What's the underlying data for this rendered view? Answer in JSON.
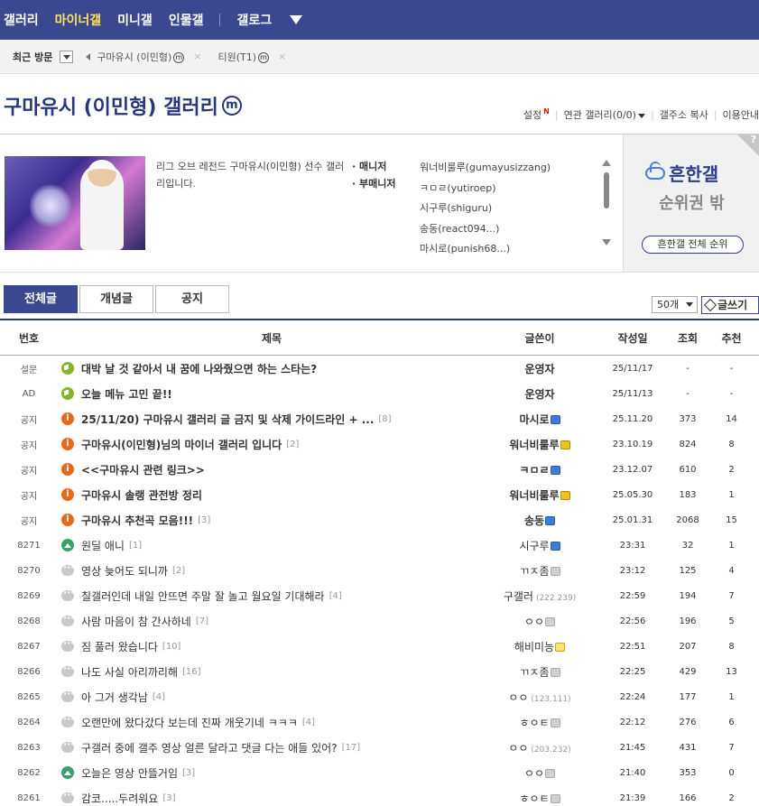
{
  "topnav": {
    "items": [
      "갤러리",
      "마이너갤",
      "미니갤",
      "인물갤"
    ],
    "extra": "갤로그"
  },
  "recent": {
    "label": "최근 방문",
    "visits": [
      "구마유시 (이민형)",
      "티원(T1)"
    ]
  },
  "gallery": {
    "title": "구마유시 (이민형) 갤러리",
    "mbadge": "m"
  },
  "util": {
    "settings": "설정",
    "related": "연관 갤러리(0/0)",
    "copy": "갤주소 복사",
    "guide": "이용안내"
  },
  "info": {
    "desc": "리그 오브 레전드 구마유시(이민형) 선수 갤러리입니다.",
    "manager_label": "· 매니저",
    "submanager_label": "· 부매니저",
    "managers": [
      "워너비룰루(gumayusizzang)",
      "ㅋㅁㄹ(yutiroep)",
      "시구루(shiguru)",
      "송동(react094...)",
      "마시로(punish68...)"
    ]
  },
  "rank": {
    "brand": "흔한갤",
    "status": "순위권 밖",
    "button": "흔한갤 전체 순위",
    "help": "?"
  },
  "tabs": [
    "전체글",
    "개념글",
    "공지"
  ],
  "perpage": "50개",
  "write": "글쓰기",
  "table": {
    "headers": {
      "num": "번호",
      "title": "제목",
      "writer": "글쓴이",
      "date": "작성일",
      "views": "조회",
      "rec": "추천"
    },
    "rows": [
      {
        "num": "설문",
        "icon": "speaker",
        "title": "대박 날 것 같아서 내 꿈에 나와줬으면 하는 스타는?",
        "count": "",
        "writer": "운영자",
        "ip": "",
        "badge": "",
        "date": "25/11/17",
        "views": "-",
        "rec": "-",
        "bold": true
      },
      {
        "num": "AD",
        "icon": "speaker",
        "title": "오늘 메뉴 고민 끝!!",
        "count": "",
        "writer": "운영자",
        "ip": "",
        "badge": "",
        "date": "25/11/13",
        "views": "-",
        "rec": "-",
        "bold": true
      },
      {
        "num": "공지",
        "icon": "notice",
        "title": "25/11/20) 구마유시 갤러리 글 금지 및 삭제 가이드라인 + ...",
        "count": "[8]",
        "writer": "마시로",
        "ip": "",
        "badge": "blue",
        "date": "25.11.20",
        "views": "373",
        "rec": "14",
        "bold": true
      },
      {
        "num": "공지",
        "icon": "notice",
        "title": "구마유시(이민형)님의 마이너 갤러리 입니다",
        "count": "[2]",
        "writer": "워너비룰루",
        "ip": "",
        "badge": "gold",
        "date": "23.10.19",
        "views": "824",
        "rec": "8",
        "bold": true
      },
      {
        "num": "공지",
        "icon": "notice",
        "title": "<<구마유시 관련 링크>>",
        "count": "",
        "writer": "ㅋㅁㄹ",
        "ip": "",
        "badge": "blue",
        "date": "23.12.07",
        "views": "610",
        "rec": "2",
        "bold": true
      },
      {
        "num": "공지",
        "icon": "notice",
        "title": "구마유시 솔랭 관전방 정리",
        "count": "",
        "writer": "워너비룰루",
        "ip": "",
        "badge": "gold",
        "date": "25.05.30",
        "views": "183",
        "rec": "1",
        "bold": true
      },
      {
        "num": "공지",
        "icon": "notice",
        "title": "구마유시 추천곡 모음!!!",
        "count": "[3]",
        "writer": "송동",
        "ip": "",
        "badge": "blue",
        "date": "25.01.31",
        "views": "2068",
        "rec": "15",
        "bold": true
      },
      {
        "num": "8271",
        "icon": "img",
        "title": "원딜 애니",
        "count": "[1]",
        "writer": "시구루",
        "ip": "",
        "badge": "blue",
        "date": "23:31",
        "views": "32",
        "rec": "1",
        "bold": false
      },
      {
        "num": "8270",
        "icon": "txt",
        "title": "영상 늦어도 되니까",
        "count": "[2]",
        "writer": "ㄲㅈ좀",
        "ip": "",
        "badge": "gray",
        "date": "23:12",
        "views": "125",
        "rec": "4",
        "bold": false
      },
      {
        "num": "8269",
        "icon": "txt",
        "title": "칠갤러인데 내일 안뜨면 주말 잘 놀고 월요일 기대해라",
        "count": "[4]",
        "writer": "구갤러",
        "ip": "(222.239)",
        "badge": "",
        "date": "22:59",
        "views": "194",
        "rec": "7",
        "bold": false
      },
      {
        "num": "8268",
        "icon": "txt",
        "title": "사람 마음이 참 간사하네",
        "count": "[7]",
        "writer": "ㅇㅇ",
        "ip": "",
        "badge": "gray",
        "date": "22:56",
        "views": "196",
        "rec": "5",
        "bold": false
      },
      {
        "num": "8267",
        "icon": "txt",
        "title": "짐 풀러 왔습니다",
        "count": "[10]",
        "writer": "해비미능",
        "ip": "",
        "badge": "yel",
        "date": "22:51",
        "views": "207",
        "rec": "8",
        "bold": false
      },
      {
        "num": "8266",
        "icon": "txt",
        "title": "나도 사실 아리까리해",
        "count": "[16]",
        "writer": "ㄲㅈ좀",
        "ip": "",
        "badge": "gray",
        "date": "22:25",
        "views": "429",
        "rec": "13",
        "bold": false
      },
      {
        "num": "8265",
        "icon": "txt",
        "title": "아 그거 생각남",
        "count": "[4]",
        "writer": "ㅇㅇ",
        "ip": "(123.111)",
        "badge": "",
        "date": "22:24",
        "views": "177",
        "rec": "1",
        "bold": false
      },
      {
        "num": "8264",
        "icon": "txt",
        "title": "오랜만에 왔다갔다 보는데 진짜 개웃기네 ㅋㅋㅋ",
        "count": "[4]",
        "writer": "ㅎㅇㅌ",
        "ip": "",
        "badge": "gray",
        "date": "22:12",
        "views": "276",
        "rec": "6",
        "bold": false
      },
      {
        "num": "8263",
        "icon": "txt",
        "title": "구갤러 중에 갤주 영상 얼른 달라고 댓글 다는 애들 있어?",
        "count": "[17]",
        "writer": "ㅇㅇ",
        "ip": "(203.232)",
        "badge": "",
        "date": "21:45",
        "views": "431",
        "rec": "7",
        "bold": false
      },
      {
        "num": "8262",
        "icon": "img",
        "title": "오늘은 영상 안뜰거임",
        "count": "[3]",
        "writer": "ㅇㅇ",
        "ip": "",
        "badge": "gray",
        "date": "21:40",
        "views": "353",
        "rec": "0",
        "bold": false
      },
      {
        "num": "8261",
        "icon": "txt",
        "title": "감코.....두려워요",
        "count": "[3]",
        "writer": "ㅎㅇㅌ",
        "ip": "",
        "badge": "gray",
        "date": "21:39",
        "views": "166",
        "rec": "2",
        "bold": false
      }
    ]
  }
}
